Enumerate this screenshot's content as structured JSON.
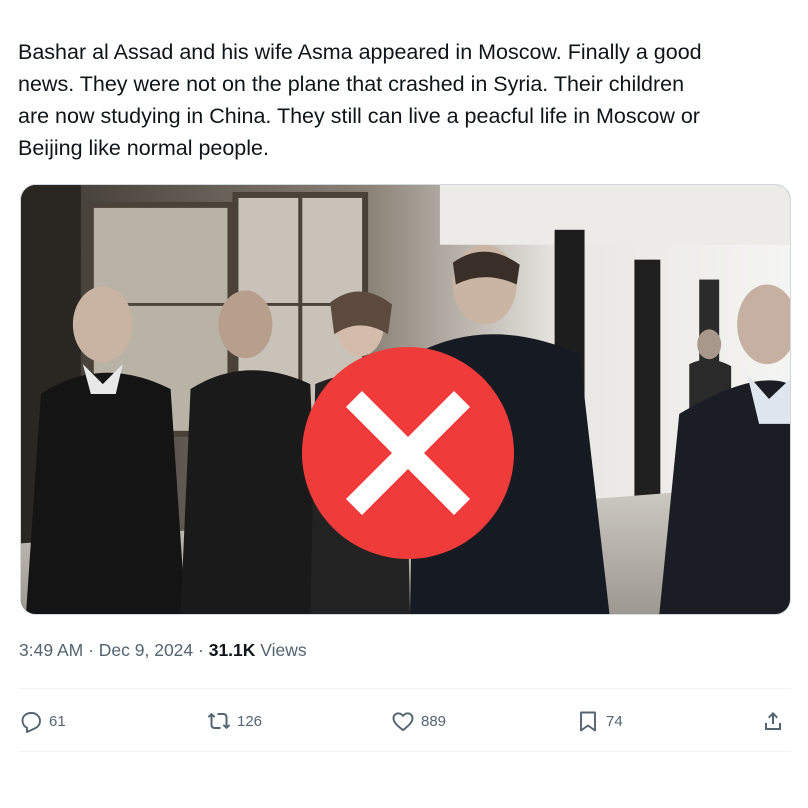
{
  "tweet": {
    "text": "Bashar al Assad and his wife Asma appeared in Moscow. Finally a good\nnews. They were not on the plane that crashed in Syria. Their children\nare now studying in China.  They still can live a peacful life in Moscow or\nBeijing like normal people."
  },
  "meta": {
    "time": "3:49 AM",
    "separator1": " · ",
    "date": "Dec 9, 2024",
    "separator2": " · ",
    "views_count": "31.1K",
    "views_label": " Views"
  },
  "actions": {
    "replies": "61",
    "reposts": "126",
    "likes": "889",
    "bookmarks": "74"
  },
  "media": {
    "overlay_icon": "red-x-icon",
    "overlay_color": "#f03b3b"
  },
  "icons": {
    "reply": "reply-icon",
    "repost": "repost-icon",
    "like": "like-icon",
    "bookmark": "bookmark-icon",
    "share": "share-icon"
  },
  "colors": {
    "text": "#0f1419",
    "secondary": "#536471",
    "divider": "#eff3f4"
  }
}
